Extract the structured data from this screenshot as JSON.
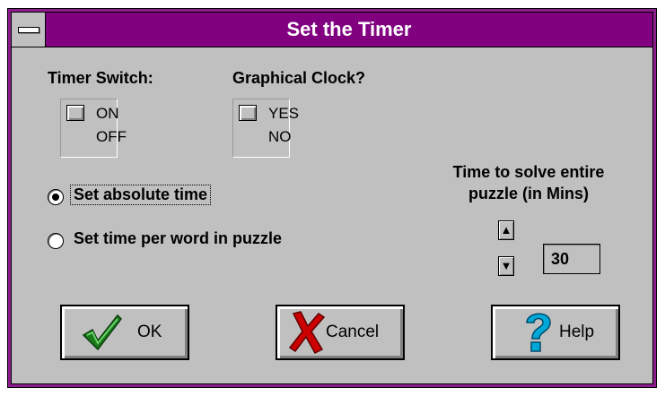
{
  "window": {
    "title": "Set the Timer"
  },
  "timer_switch": {
    "label": "Timer Switch:",
    "on": "ON",
    "off": "OFF"
  },
  "graphical_clock": {
    "label": "Graphical Clock?",
    "yes": "YES",
    "no": "NO"
  },
  "mode": {
    "absolute_label": "Set absolute time",
    "per_word_label": "Set time per word in puzzle",
    "selected": "absolute"
  },
  "time": {
    "label_line1": "Time to solve entire",
    "label_line2": "puzzle (in Mins)",
    "value": "30"
  },
  "buttons": {
    "ok": "OK",
    "cancel": "Cancel",
    "help": "Help"
  },
  "icons": {
    "ok": "checkmark-icon",
    "cancel": "x-mark-icon",
    "help": "question-mark-icon",
    "spin_up": "arrow-up-icon",
    "spin_down": "arrow-down-icon"
  },
  "colors": {
    "titlebar": "#800080",
    "face": "#c0c0c0",
    "ok_icon": "#1a7a1a",
    "cancel_icon": "#cc0000",
    "help_icon": "#00a8d8"
  }
}
